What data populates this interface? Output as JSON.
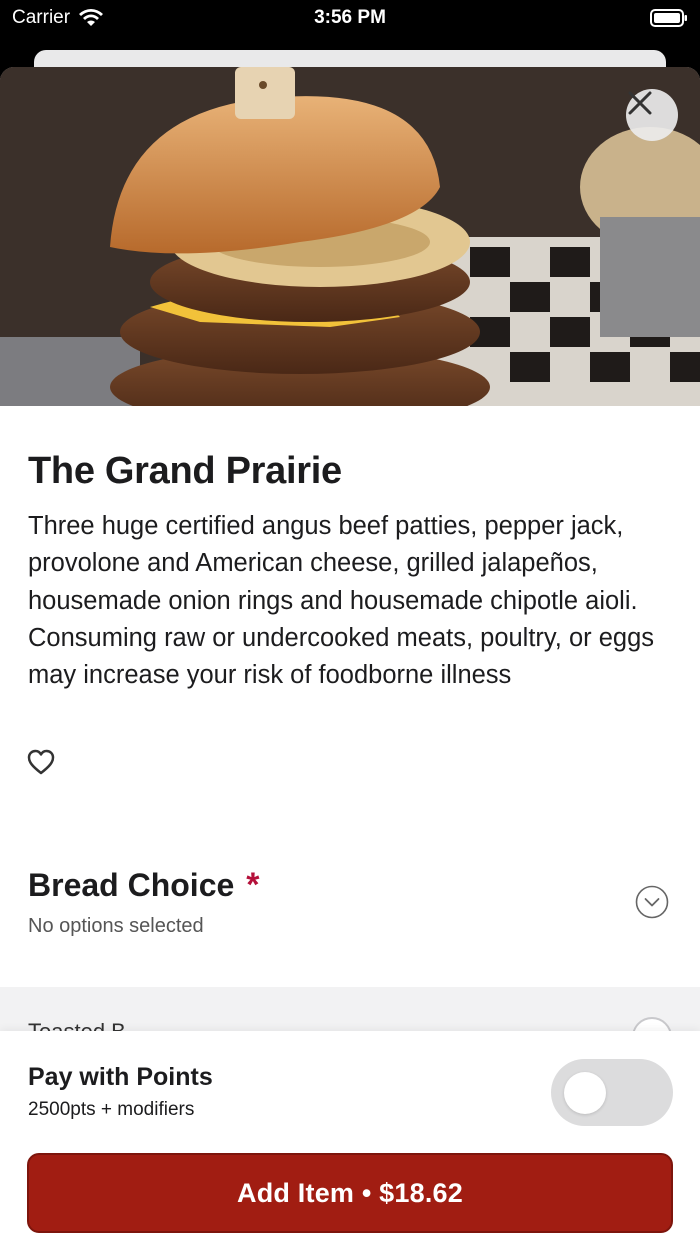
{
  "status_bar": {
    "carrier": "Carrier",
    "time": "3:56 PM",
    "icons": [
      "wifi-icon",
      "battery-icon"
    ]
  },
  "item": {
    "title": "The Grand Prairie",
    "description": "Three huge certified angus beef patties, pepper jack, provolone and American cheese, grilled jalapeños, housemade onion rings and housemade chipotle aioli. Consuming raw or undercooked meats, poultry, or eggs may increase your risk of foodborne illness",
    "favorite_icon": "heart-outline-icon",
    "close_icon": "close-icon"
  },
  "sections": [
    {
      "title": "Bread Choice",
      "required_mark": "*",
      "subtitle": "No options selected",
      "expand_icon": "chevron-down-circle-icon"
    }
  ],
  "option_peek": "Toasted B",
  "pay_with_points": {
    "title": "Pay with Points",
    "subtitle": "2500pts + modifiers",
    "enabled": false
  },
  "add_button": {
    "label": "Add Item • $18.62"
  },
  "colors": {
    "accent": "#a11d12",
    "required": "#b4103a",
    "toggle_off": "#dcdcdd"
  }
}
